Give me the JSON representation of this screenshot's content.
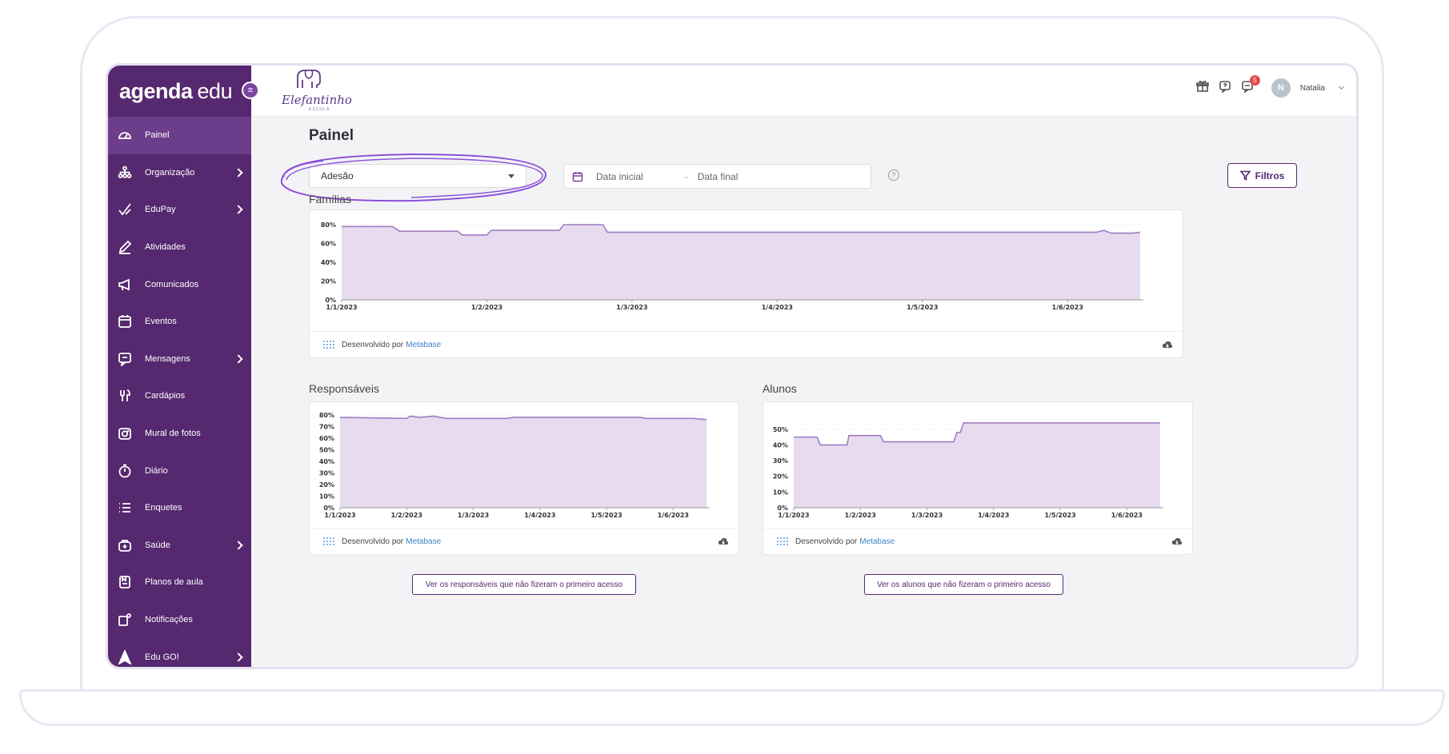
{
  "brand": {
    "logo_bold": "agenda",
    "logo_light": "edu"
  },
  "school": {
    "name": "Elefantinho",
    "subtitle": "ESCOLA"
  },
  "sidebar": {
    "items": [
      {
        "label": "Painel",
        "icon": "dashboard-icon",
        "active": true,
        "has_submenu": false
      },
      {
        "label": "Organização",
        "icon": "organization-icon",
        "has_submenu": true
      },
      {
        "label": "EduPay",
        "icon": "check-pen-icon",
        "has_submenu": true
      },
      {
        "label": "Atividades",
        "icon": "pencil-icon",
        "has_submenu": false
      },
      {
        "label": "Comunicados",
        "icon": "megaphone-icon",
        "has_submenu": false
      },
      {
        "label": "Eventos",
        "icon": "calendar-icon",
        "has_submenu": false
      },
      {
        "label": "Mensagens",
        "icon": "chat-icon",
        "has_submenu": true
      },
      {
        "label": "Cardápios",
        "icon": "cutlery-icon",
        "has_submenu": false
      },
      {
        "label": "Mural de fotos",
        "icon": "camera-icon",
        "has_submenu": false
      },
      {
        "label": "Diário",
        "icon": "timer-icon",
        "has_submenu": false
      },
      {
        "label": "Enquetes",
        "icon": "list-icon",
        "has_submenu": false
      },
      {
        "label": "Saúde",
        "icon": "medical-kit-icon",
        "has_submenu": true
      },
      {
        "label": "Planos de aula",
        "icon": "lesson-plan-icon",
        "has_submenu": false
      },
      {
        "label": "Notificações",
        "icon": "bell-icon",
        "has_submenu": false
      },
      {
        "label": "Edu GO!",
        "icon": "arrow-up-icon",
        "has_submenu": true
      }
    ]
  },
  "topbar": {
    "notifications_count": "5",
    "avatar_initial": "N",
    "user_name": "Natalia"
  },
  "page": {
    "title": "Painel",
    "select_value": "Adesão",
    "date_start_placeholder": "Data inicial",
    "date_separator": "-",
    "date_end_placeholder": "Data final",
    "help": "?",
    "filters_label": "Filtros"
  },
  "sections": {
    "familias": "Famílias",
    "responsaveis": "Responsáveis",
    "alunos": "Alunos"
  },
  "footer": {
    "powered_by": "Desenvolvido por",
    "metabase": "Metabase"
  },
  "buttons": {
    "responsaveis_first_access": "Ver os responsáveis que não fizeram o primeiro acesso",
    "alunos_first_access": "Ver os alunos que não fizeram o primeiro acesso"
  },
  "colors": {
    "primary": "#55286f",
    "area_fill": "#e6dbef",
    "area_line": "#a07cc2",
    "accent_link": "#3b82c4"
  },
  "chart_data": [
    {
      "type": "area",
      "title": "Famílias",
      "x": [
        "1/1/2023",
        "1/2/2023",
        "1/3/2023",
        "1/4/2023",
        "1/5/2023",
        "1/6/2023"
      ],
      "y_ticks": [
        "0%",
        "20%",
        "40%",
        "60%",
        "80%"
      ],
      "ylim": [
        0,
        80
      ],
      "points": [
        [
          0,
          78
        ],
        [
          0.35,
          78
        ],
        [
          0.4,
          73
        ],
        [
          0.8,
          73
        ],
        [
          0.83,
          69
        ],
        [
          1.0,
          69
        ],
        [
          1.03,
          74
        ],
        [
          1.5,
          74
        ],
        [
          1.53,
          80
        ],
        [
          1.8,
          80
        ],
        [
          1.83,
          72
        ],
        [
          5.2,
          72
        ],
        [
          5.25,
          74
        ],
        [
          5.3,
          71
        ],
        [
          5.45,
          71
        ],
        [
          5.5,
          72
        ]
      ],
      "grid": true
    },
    {
      "type": "area",
      "title": "Responsáveis",
      "x": [
        "1/1/2023",
        "1/2/2023",
        "1/3/2023",
        "1/4/2023",
        "1/5/2023",
        "1/6/2023"
      ],
      "y_ticks": [
        "0%",
        "10%",
        "20%",
        "30%",
        "40%",
        "50%",
        "60%",
        "70%",
        "80%"
      ],
      "ylim": [
        0,
        80
      ],
      "points": [
        [
          0,
          78
        ],
        [
          1,
          77
        ],
        [
          1.05,
          79
        ],
        [
          1.2,
          78
        ],
        [
          1.4,
          79
        ],
        [
          1.6,
          77
        ],
        [
          2.5,
          77
        ],
        [
          2.6,
          78
        ],
        [
          4.5,
          78
        ],
        [
          4.6,
          77
        ],
        [
          5.3,
          77
        ],
        [
          5.5,
          76
        ]
      ],
      "grid": true
    },
    {
      "type": "area",
      "title": "Alunos",
      "x": [
        "1/1/2023",
        "1/2/2023",
        "1/3/2023",
        "1/4/2023",
        "1/5/2023",
        "1/6/2023"
      ],
      "y_ticks": [
        "0%",
        "10%",
        "20%",
        "30%",
        "40%",
        "50%"
      ],
      "ylim": [
        0,
        55
      ],
      "points": [
        [
          0,
          45
        ],
        [
          0.35,
          45
        ],
        [
          0.4,
          40
        ],
        [
          0.8,
          40
        ],
        [
          0.83,
          46
        ],
        [
          1.3,
          46
        ],
        [
          1.35,
          42
        ],
        [
          2.4,
          42
        ],
        [
          2.45,
          48
        ],
        [
          2.5,
          48
        ],
        [
          2.55,
          54
        ],
        [
          5.5,
          54
        ]
      ],
      "grid": true
    }
  ]
}
